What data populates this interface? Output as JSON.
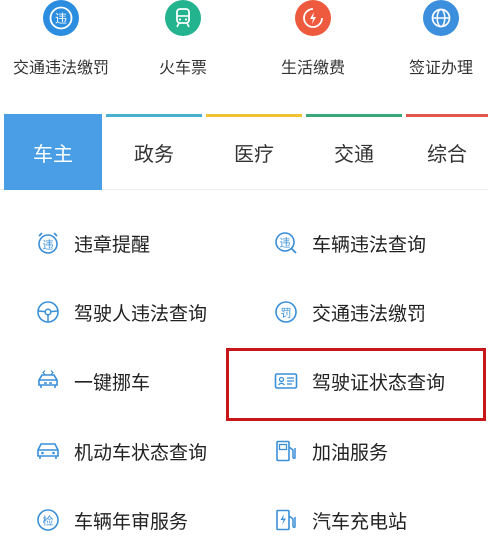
{
  "quick_services": [
    {
      "label": "交通违法缴罚",
      "icon": "violation-badge-icon",
      "color": "#2b8de0",
      "glyph": "违"
    },
    {
      "label": "火车票",
      "icon": "train-icon",
      "color": "#24b38f",
      "glyph": ""
    },
    {
      "label": "生活缴费",
      "icon": "lightning-bill-icon",
      "color": "#ee5a3e",
      "glyph": ""
    },
    {
      "label": "签证办理",
      "icon": "globe-icon",
      "color": "#3c8fdd",
      "glyph": ""
    }
  ],
  "tabs": [
    {
      "label": "车主",
      "active": true,
      "bar_color": "#4a9ee6"
    },
    {
      "label": "政务",
      "active": false,
      "bar_color": "#4ab0d0"
    },
    {
      "label": "医疗",
      "active": false,
      "bar_color": "#f1c232"
    },
    {
      "label": "交通",
      "active": false,
      "bar_color": "#3aa879"
    },
    {
      "label": "综合",
      "active": false,
      "bar_color": "#e2574c"
    }
  ],
  "services": [
    {
      "label": "违章提醒",
      "icon": "violation-alarm-icon"
    },
    {
      "label": "车辆违法查询",
      "icon": "violation-search-icon"
    },
    {
      "label": "驾驶人违法查询",
      "icon": "steering-wheel-icon"
    },
    {
      "label": "交通违法缴罚",
      "icon": "fine-payment-icon"
    },
    {
      "label": "一键挪车",
      "icon": "move-car-icon"
    },
    {
      "label": "驾驶证状态查询",
      "icon": "license-card-icon"
    },
    {
      "label": "机动车状态查询",
      "icon": "car-status-icon"
    },
    {
      "label": "加油服务",
      "icon": "fuel-pump-icon"
    },
    {
      "label": "车辆年审服务",
      "icon": "inspection-badge-icon"
    },
    {
      "label": "汽车充电站",
      "icon": "charging-station-icon"
    }
  ],
  "service_glyphs": {
    "violation": "违",
    "fine": "罚",
    "inspection": "检"
  },
  "accent_color": "#4a9ee6",
  "icon_color": "#3a8fd9",
  "highlight_color": "#c8161d"
}
